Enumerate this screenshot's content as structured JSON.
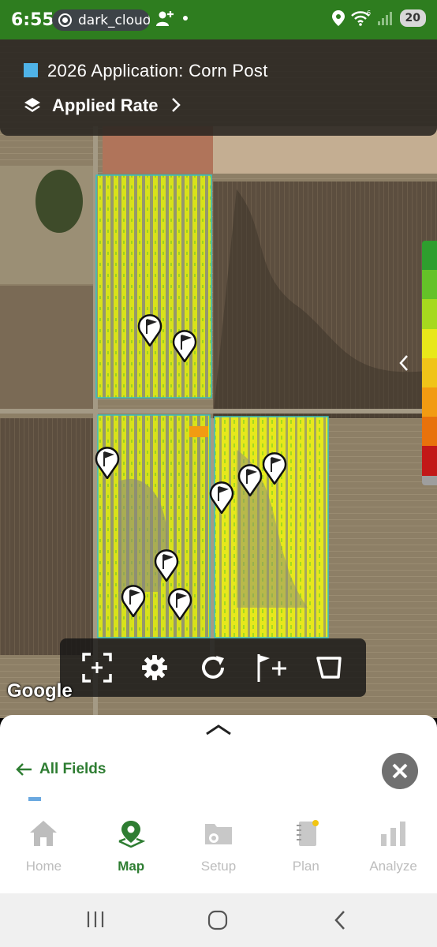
{
  "status": {
    "time": "6:55",
    "app_chip": "dark_cloud",
    "battery": "20",
    "signal_sup": "6"
  },
  "layer": {
    "title": "2026 Application: Corn Post",
    "swatch_color": "#4fb3e8",
    "view_label": "Applied Rate"
  },
  "legend_colors": [
    "#2e9e2e",
    "#64c228",
    "#a6d91f",
    "#e8e81a",
    "#f0c419",
    "#f29b12",
    "#e8720c",
    "#c21818"
  ],
  "toolbar": [
    "fit-extent-icon",
    "gear-icon",
    "refresh-icon",
    "add-flag-icon",
    "draw-boundary-icon"
  ],
  "map": {
    "attribution": "Google"
  },
  "sheet": {
    "back_label": "All Fields"
  },
  "tabs": [
    {
      "label": "Home",
      "icon": "home-icon",
      "active": false
    },
    {
      "label": "Map",
      "icon": "map-pin-icon",
      "active": true
    },
    {
      "label": "Setup",
      "icon": "folder-gear-icon",
      "active": false
    },
    {
      "label": "Plan",
      "icon": "notebook-icon",
      "active": false
    },
    {
      "label": "Analyze",
      "icon": "bar-chart-icon",
      "active": false
    }
  ],
  "colors": {
    "accent_green": "#2e7d32",
    "status_bar": "#2e7d1f",
    "inactive": "#bdbdbd"
  }
}
